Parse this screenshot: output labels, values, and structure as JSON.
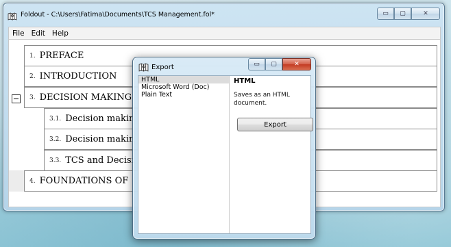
{
  "window": {
    "title": "Foldout - C:\\Users\\Fatima\\Documents\\TCS Management.fol*",
    "controls": {
      "minimize": "▭",
      "maximize": "▢",
      "close": "✕"
    }
  },
  "menu": [
    "File",
    "Edit",
    "Help"
  ],
  "outline": [
    {
      "num": "1.",
      "title": "PREFACE"
    },
    {
      "num": "2.",
      "title": "INTRODUCTION"
    },
    {
      "num": "3.",
      "title": "DECISION MAKING"
    },
    {
      "num": "3.1.",
      "title": "Decision makin"
    },
    {
      "num": "3.2.",
      "title": "Decision makin"
    },
    {
      "num": "3.3.",
      "title": "TCS and Decisi"
    },
    {
      "num": "4.",
      "title": "FOUNDATIONS OF"
    }
  ],
  "dialog": {
    "title": "Export",
    "formats": [
      "HTML",
      "Microsoft Word (Doc)",
      "Plain Text"
    ],
    "selected_format": "HTML",
    "detail_title": "HTML",
    "detail_desc": "Saves as an HTML document.",
    "export_button": "Export",
    "controls": {
      "minimize": "▭",
      "maximize": "▢",
      "close": "✕"
    }
  },
  "icons": {
    "app": "foldout-app-icon",
    "collapse": "minus-box-icon"
  }
}
